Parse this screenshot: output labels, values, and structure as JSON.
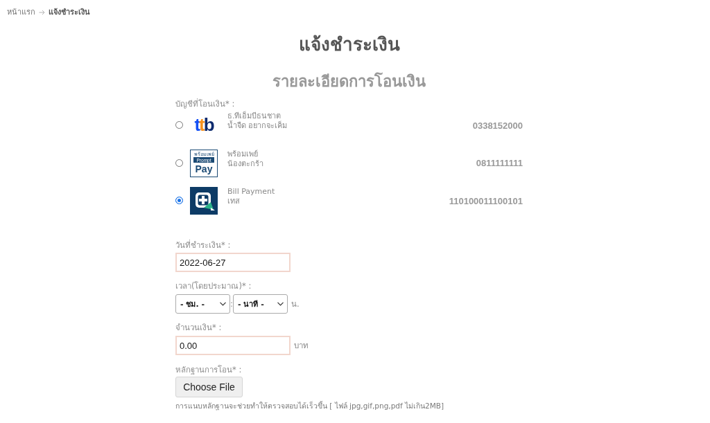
{
  "breadcrumb": [
    {
      "label": "หน้าแรก",
      "current": false
    },
    {
      "label": "แจ้งชำระเงิน",
      "current": true
    }
  ],
  "title": "แจ้งชำระเงิน",
  "section_title": "รายละเอียดการโอนเงิน",
  "form": {
    "account_label": "บัญชีที่โอนเงิน* :",
    "accounts": [
      {
        "kind": "ttb",
        "logo_text": [
          "ttb"
        ],
        "name": "ธ.ทีเอ็มบีธนชาต",
        "holder": "น้ำจืด อยากจะเค็ม",
        "number": "0338152000",
        "selected": false
      },
      {
        "kind": "promptpay",
        "logo_text": [
          "พร้อมเพย์",
          "Prompt",
          "Pay"
        ],
        "name": "พร้อมเพย์",
        "holder": "น้องตะกร้า",
        "number": "0811111111",
        "selected": false
      },
      {
        "kind": "billpayment",
        "name": "Bill Payment",
        "holder": "เทส",
        "number": "110100011100101",
        "selected": true
      }
    ],
    "date_field": {
      "label": "วันที่ชำระเงิน* :",
      "value": "2022-06-27"
    },
    "time_field": {
      "label": "เวลา(โดยประมาณ)* :",
      "hour_select": "- ชม. -",
      "separator": ":",
      "minute_select": "- นาที -",
      "unit": "น."
    },
    "amount_field": {
      "label": "จำนวนเงิน* :",
      "value": "0.00",
      "unit": "บาท"
    },
    "proof_field": {
      "label": "หลักฐานการโอน* :",
      "button": "Choose File",
      "hint": "การแนบหลักฐานจะช่วยทำให้ตรวจสอบได้เร็วขึ้น [ ไฟล์ jpg,gif,png,pdf ไม่เกิน2MB]"
    }
  }
}
